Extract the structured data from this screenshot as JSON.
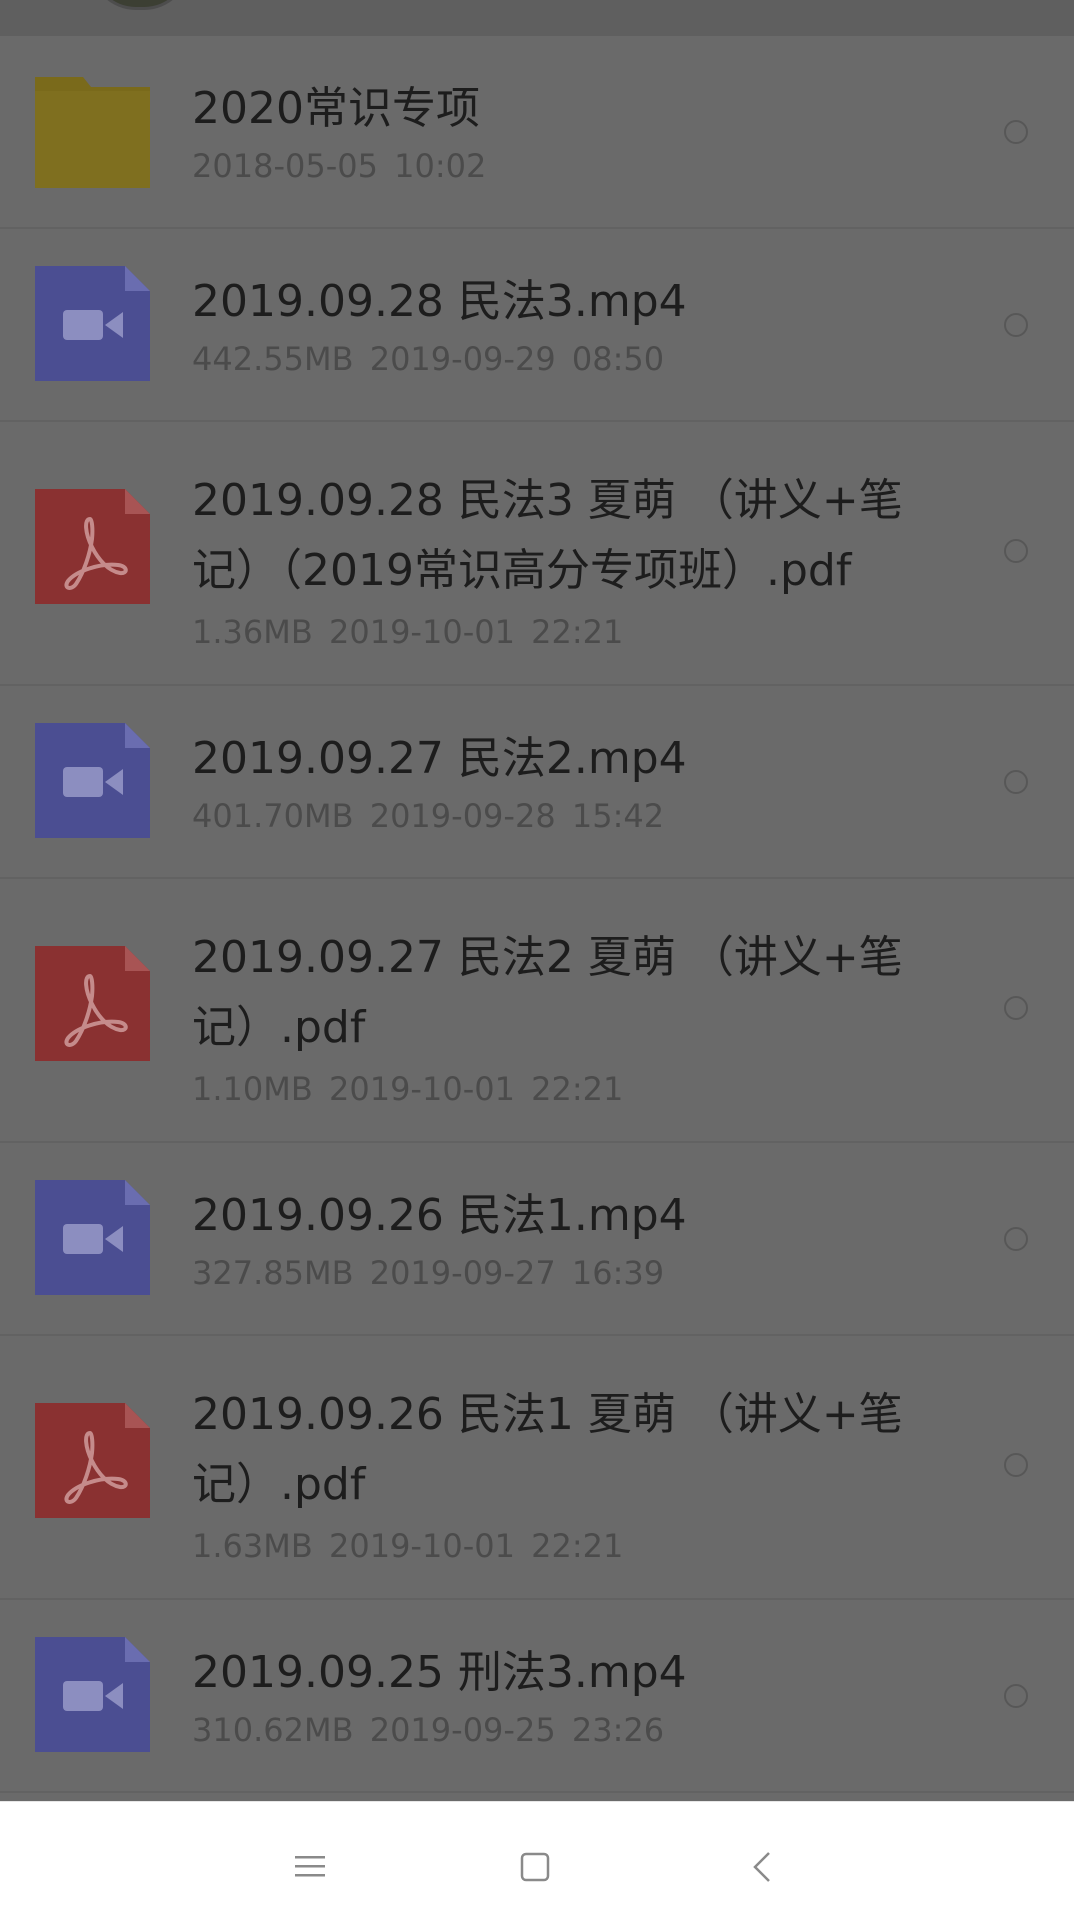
{
  "files": [
    {
      "type": "folder",
      "name": "2020常识专项",
      "meta": "2018-05-05  10:02"
    },
    {
      "type": "video",
      "name": "2019.09.28 民法3.mp4",
      "meta": "442.55MB  2019-09-29  08:50"
    },
    {
      "type": "pdf",
      "name": "2019.09.28 民法3 夏萌 （讲义+笔记）（2019常识高分专项班）.pdf",
      "meta": "1.36MB  2019-10-01  22:21"
    },
    {
      "type": "video",
      "name": "2019.09.27 民法2.mp4",
      "meta": "401.70MB  2019-09-28  15:42"
    },
    {
      "type": "pdf",
      "name": "2019.09.27 民法2 夏萌 （讲义+笔记）.pdf",
      "meta": "1.10MB  2019-10-01  22:21"
    },
    {
      "type": "video",
      "name": "2019.09.26 民法1.mp4",
      "meta": "327.85MB  2019-09-27  16:39"
    },
    {
      "type": "pdf",
      "name": "2019.09.26 民法1 夏萌 （讲义+笔记）.pdf",
      "meta": "1.63MB  2019-10-01  22:21"
    },
    {
      "type": "video",
      "name": "2019.09.25 刑法3.mp4",
      "meta": "310.62MB  2019-09-25  23:26"
    }
  ],
  "colors": {
    "folder": "#7a6a1b",
    "video": "#4b4e92",
    "pdf": "#8a3131"
  },
  "nav": {
    "menu_icon": "menu-icon",
    "home_icon": "home-icon",
    "back_icon": "back-icon"
  }
}
